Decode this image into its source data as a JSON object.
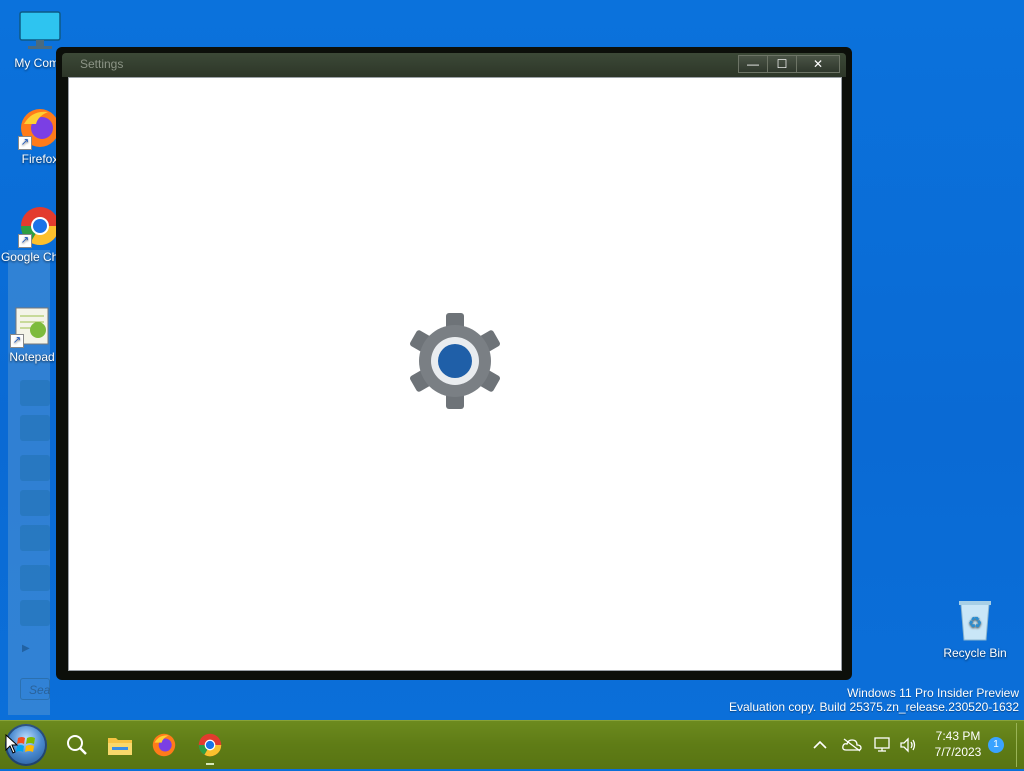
{
  "desktop": {
    "icons": [
      {
        "label": "My Comp"
      },
      {
        "label": "Firefox"
      },
      {
        "label": "Google Chrom"
      },
      {
        "label": "Notepad"
      }
    ],
    "recycle_bin": "Recycle Bin",
    "side_panel_search": "Sea"
  },
  "window": {
    "title": "Settings",
    "minimize": "—",
    "maximize": "☐",
    "close": "✕"
  },
  "watermark": {
    "line1": "Windows 11 Pro Insider Preview",
    "line2": "Evaluation copy. Build 25375.zn_release.230520-1632"
  },
  "taskbar": {
    "apps": [
      "start",
      "search",
      "file-explorer",
      "firefox",
      "chrome"
    ],
    "time": "7:43 PM",
    "date": "7/7/2023",
    "notification_count": "1"
  },
  "colors": {
    "desktop": "#0a6fd8",
    "taskbar": "#5f7c16",
    "gear_accent": "#1f5fa8"
  }
}
